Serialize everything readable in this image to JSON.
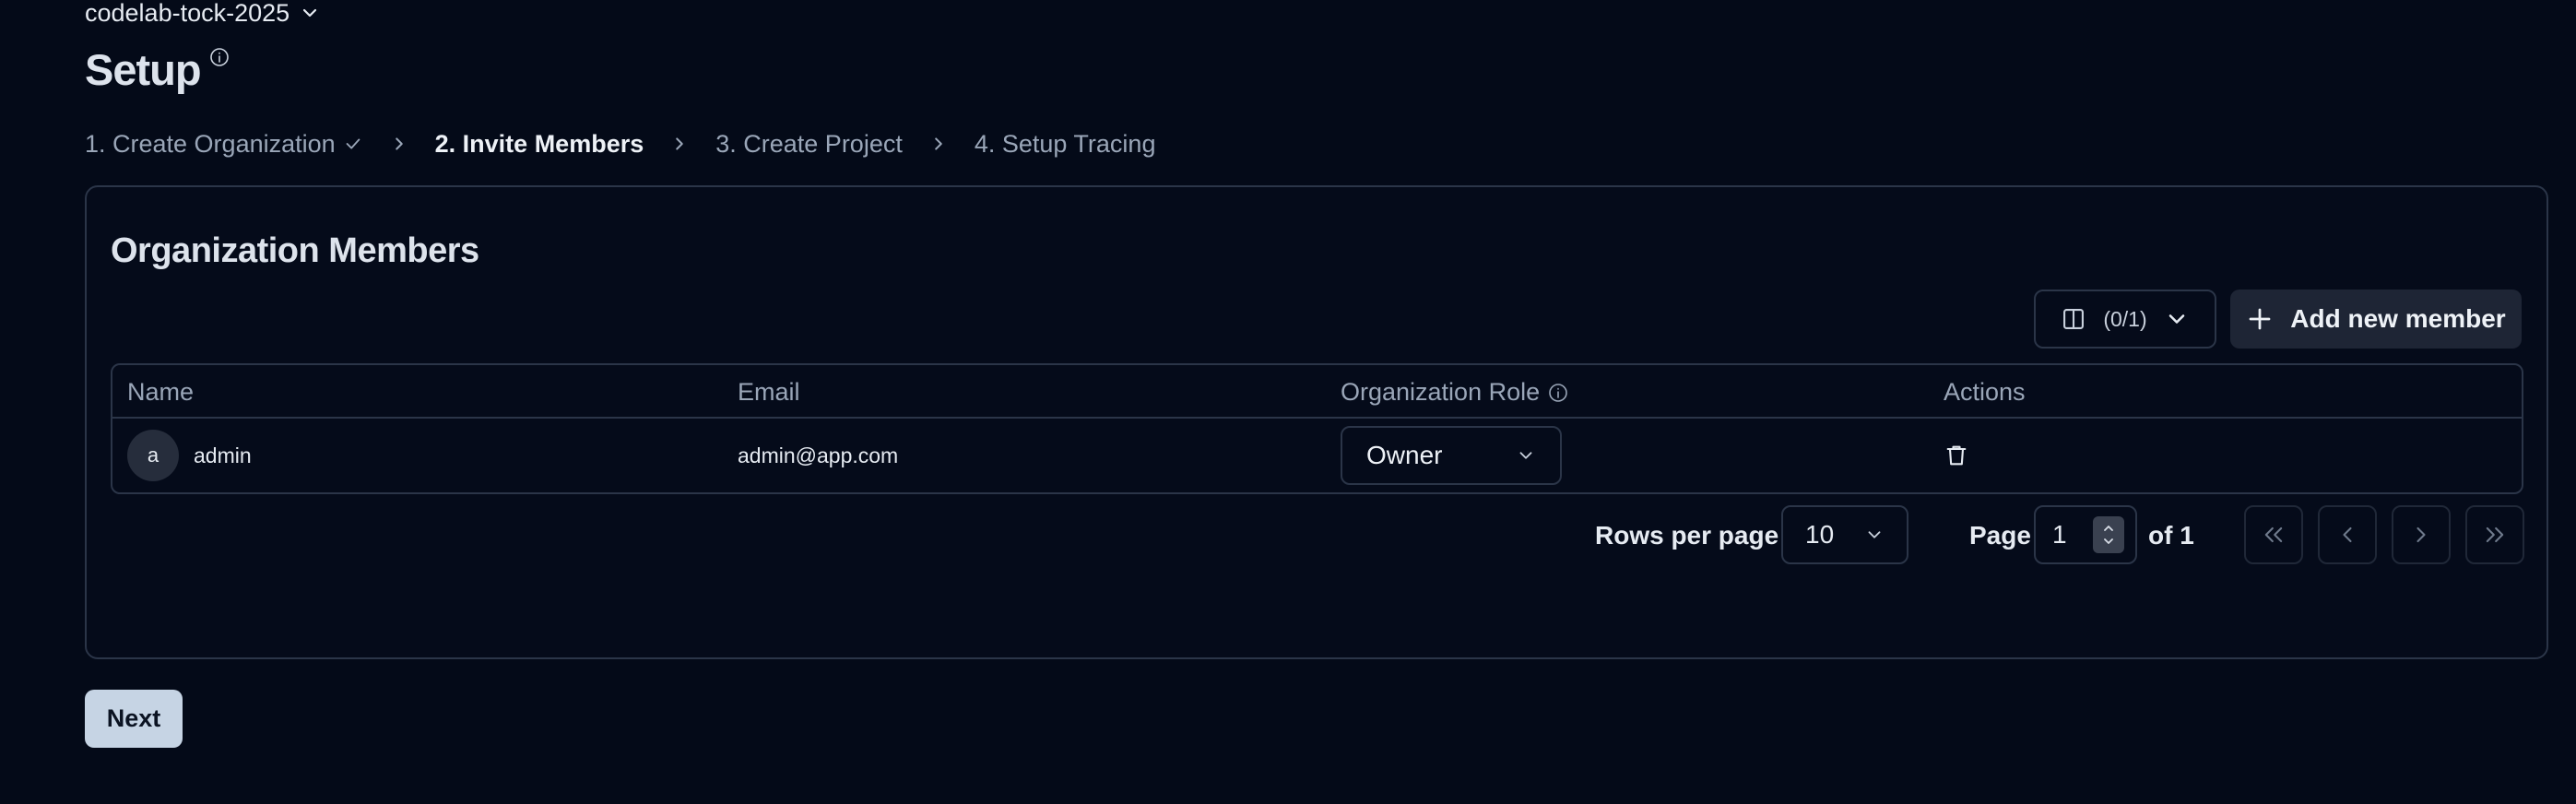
{
  "org_switcher": {
    "name": "codelab-tock-2025"
  },
  "page": {
    "title": "Setup"
  },
  "steps": [
    {
      "label": "1. Create Organization",
      "done": true
    },
    {
      "label": "2. Invite Members",
      "active": true
    },
    {
      "label": "3. Create Project"
    },
    {
      "label": "4. Setup Tracing"
    }
  ],
  "card": {
    "title": "Organization Members",
    "columns_button": "(0/1)",
    "add_button": "Add new member"
  },
  "table": {
    "headers": [
      "Name",
      "Email",
      "Organization Role",
      "Actions"
    ],
    "rows": [
      {
        "initial": "a",
        "name": "admin",
        "email": "admin@app.com",
        "role": "Owner"
      }
    ]
  },
  "pagination": {
    "rows_per_page_label": "Rows per page",
    "rows_per_page": "10",
    "page_label": "Page",
    "page_value": "1",
    "of_label": "of 1"
  },
  "footer": {
    "next_label": "Next"
  },
  "colors": {
    "background": "#040a18",
    "border": "#2b3548",
    "primary_button": "#c6d4e4"
  }
}
